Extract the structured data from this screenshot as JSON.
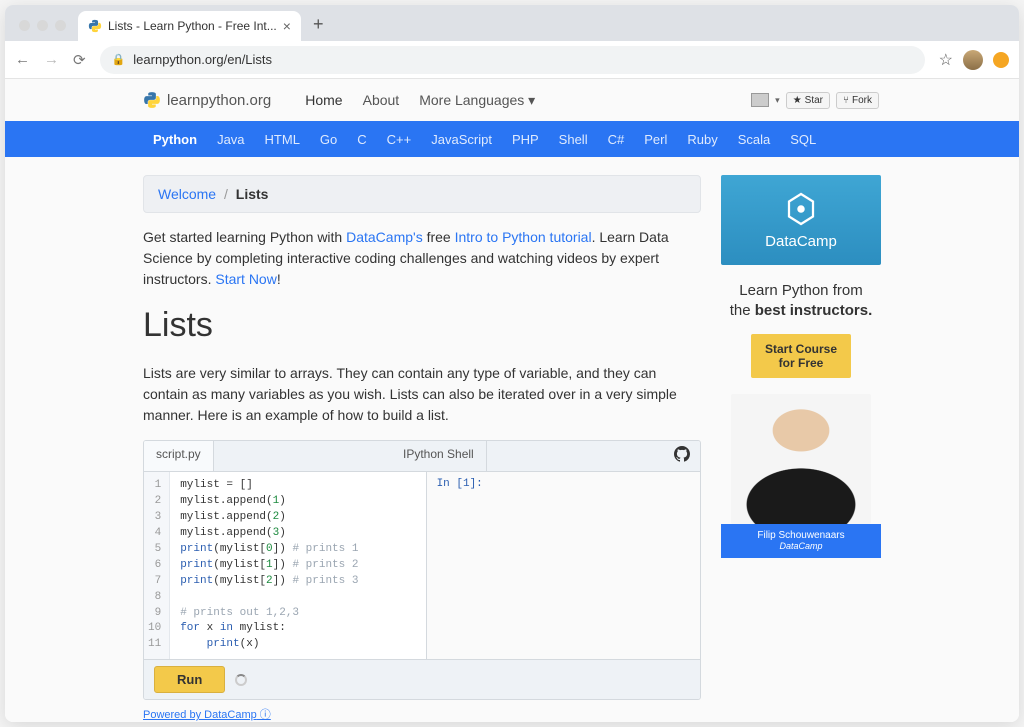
{
  "browser": {
    "tab_title": "Lists - Learn Python - Free Int...",
    "url_display": "learnpython.org/en/Lists"
  },
  "topnav": {
    "brand": "learnpython.org",
    "items": [
      "Home",
      "About",
      "More Languages"
    ],
    "gh_star": "Star",
    "gh_fork": "Fork"
  },
  "langbar": [
    "Python",
    "Java",
    "HTML",
    "Go",
    "C",
    "C++",
    "JavaScript",
    "PHP",
    "Shell",
    "C#",
    "Perl",
    "Ruby",
    "Scala",
    "SQL"
  ],
  "breadcrumb": {
    "home": "Welcome",
    "current": "Lists"
  },
  "intro": {
    "p1a": "Get started learning Python with ",
    "link1": "DataCamp's",
    "p1b": " free ",
    "link2": "Intro to Python tutorial",
    "p1c": ". Learn Data Science by completing interactive coding challenges and watching videos by expert instructors. ",
    "link3": "Start Now",
    "p1d": "!"
  },
  "h1": "Lists",
  "desc": "Lists are very similar to arrays. They can contain any type of variable, and they can contain as many variables as you wish. Lists can also be iterated over in a very simple manner. Here is an example of how to build a list.",
  "editor": {
    "tab_script": "script.py",
    "tab_shell": "IPython Shell",
    "gutter": "1\n2\n3\n4\n5\n6\n7\n8\n9\n10\n11",
    "shell_prompt": "In [1]:",
    "run": "Run",
    "powered": "Powered by DataCamp"
  },
  "ad": {
    "brand": "DataCamp",
    "headline_a": "Learn Python from the ",
    "headline_b": "best instructors.",
    "cta1": "Start Course",
    "cta2": "for Free",
    "instructor_name": "Filip Schouwenaars",
    "instructor_org": "DataCamp"
  }
}
